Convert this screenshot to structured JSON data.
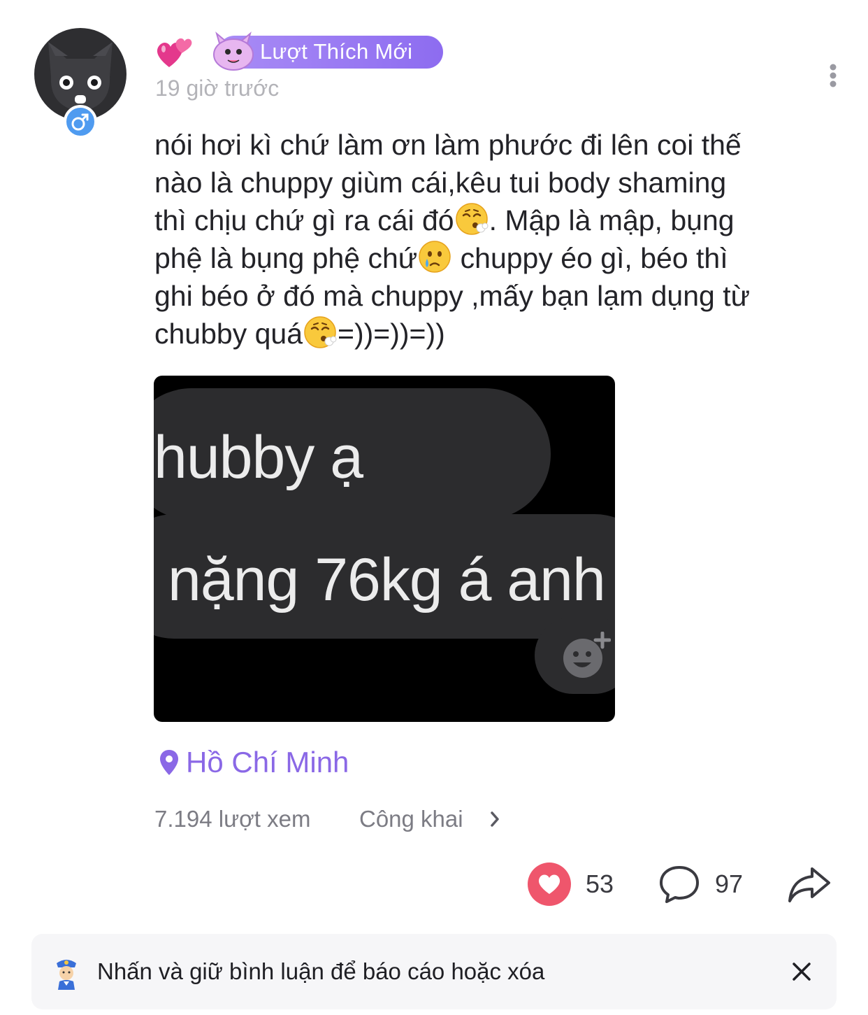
{
  "post": {
    "badge_label": "Lượt Thích Mới",
    "time": "19 giờ trước",
    "text_lines": [
      "nói hơi kì chứ làm ơn làm phước đi lên coi thế",
      "nào là chuppy giùm cái,kêu tui body shaming",
      "thì chịu chứ gì ra cái đó",
      ". Mập là mập, bụng",
      "phệ là bụng phệ chứ",
      " chuppy éo gì, béo thì",
      "ghi béo ở đó mà chuppy ,mấy bạn lạm dụng từ",
      "chubby quá",
      "=))=))=))"
    ],
    "image": {
      "bubble1_text": "hubby ạ",
      "bubble2_text": "nặng 76kg á anh"
    },
    "location": "Hồ Chí Minh",
    "views": "7.194 lượt xem",
    "privacy": "Công khai",
    "likes": "53",
    "comments": "97"
  },
  "icons": {
    "avatar": "wolf-avatar",
    "gender": "male-symbol-icon",
    "more": "more-vertical-icon",
    "location": "location-pin-icon",
    "like": "heart-icon",
    "comment": "comment-bubble-icon",
    "share": "share-arrow-icon",
    "tip": "police-officer-icon",
    "close": "close-icon"
  },
  "colors": {
    "accent": "#8a68e6",
    "badge": "#9b7cf3",
    "like": "#ef566c",
    "gender": "#4f9bf0"
  },
  "tip": {
    "text": "Nhấn và giữ bình luận để báo cáo hoặc xóa"
  }
}
